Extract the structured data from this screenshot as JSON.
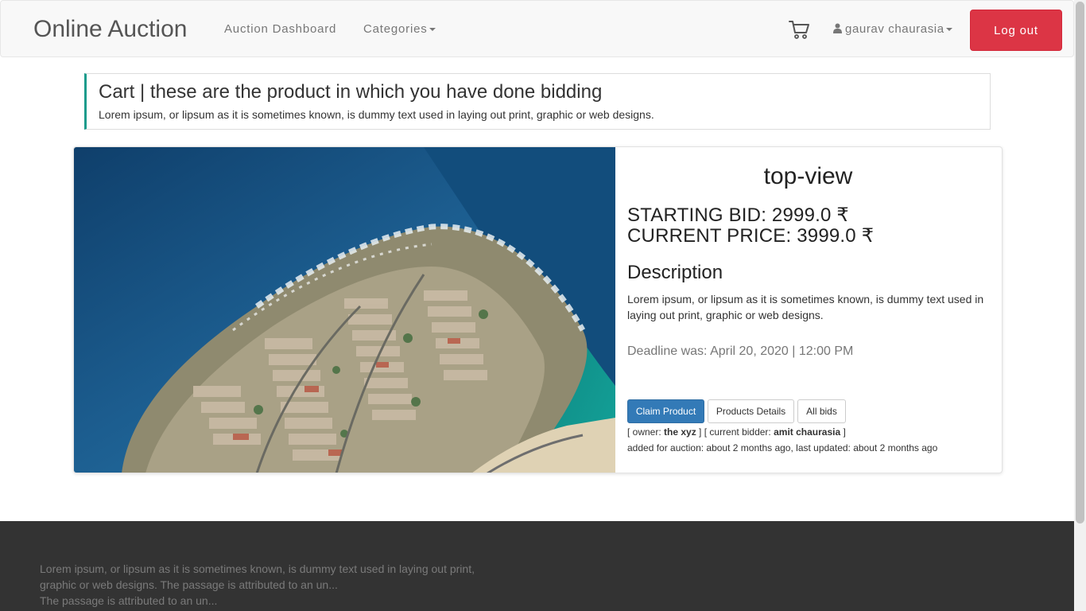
{
  "nav": {
    "brand": "Online Auction",
    "dashboard": "Auction Dashboard",
    "categories": "Categories",
    "user": "gaurav chaurasia",
    "logout": "Log out"
  },
  "header": {
    "title": "Cart | these are the product in which you have done bidding",
    "subtitle": "Lorem ipsum, or lipsum as it is sometimes known, is dummy text used in laying out print, graphic or web designs."
  },
  "product": {
    "title": "top-view",
    "starting_bid": "STARTING BID: 2999.0 ₹",
    "current_price": "CURRENT PRICE: 3999.0 ₹",
    "description_heading": "Description",
    "description": "Lorem ipsum, or lipsum as it is sometimes known, is dummy text used in laying out print, graphic or web designs.",
    "deadline": "Deadline was: April 20, 2020 | 12:00 PM",
    "buttons": {
      "claim": "Claim Product",
      "details": "Products Details",
      "bids": "All bids"
    },
    "owner_prefix": "[ owner: ",
    "owner": "the xyz",
    "bidder_prefix": " ] [ current bidder: ",
    "bidder": "amit chaurasia",
    "bidder_suffix": " ]",
    "added": "added for auction: about 2 months ago, last updated: about 2 months ago"
  },
  "footer": {
    "text_1": "Lorem ipsum, or lipsum as it is sometimes known, is dummy text used in laying out print, graphic or web designs. The passage is attributed to an un...",
    "text_2": "The passage is attributed to an un..."
  },
  "colors": {
    "danger": "#dc3545",
    "primary": "#337ab7",
    "callout_accent": "#1a9b8c",
    "footer_bg": "#333333"
  }
}
